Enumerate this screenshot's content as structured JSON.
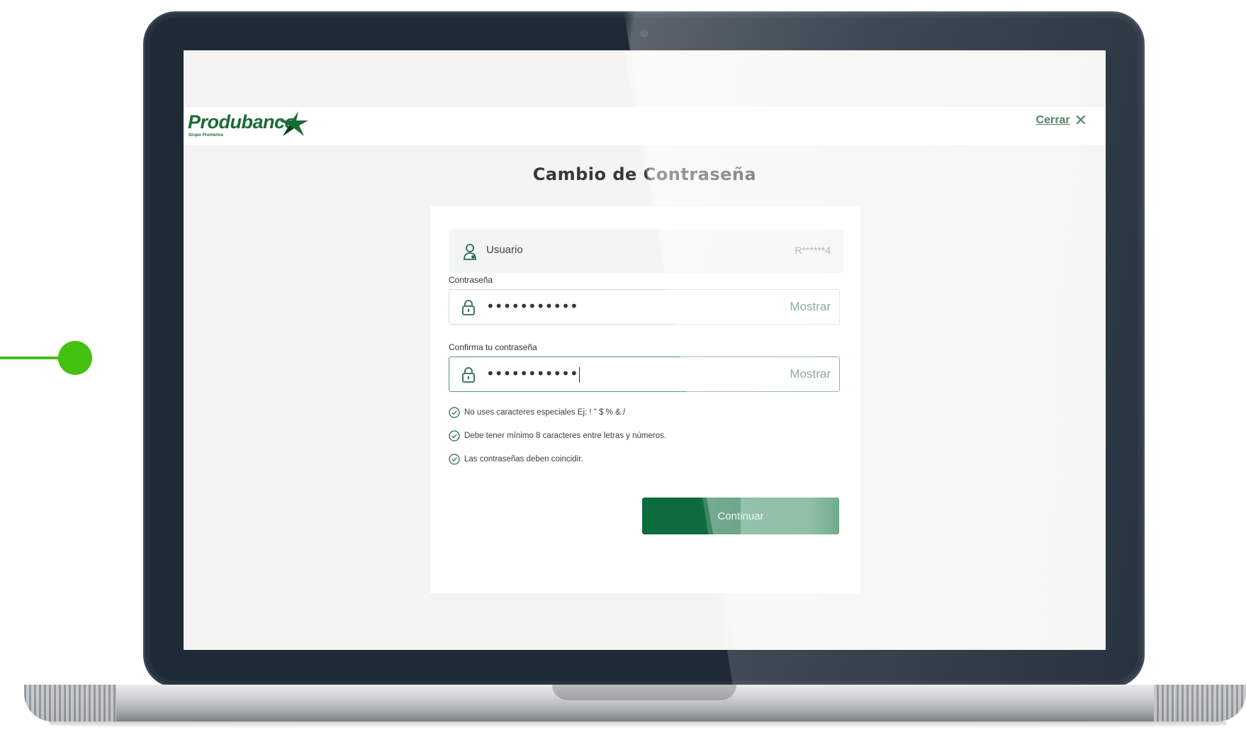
{
  "header": {
    "logo_text": "Produbanco",
    "logo_subtext": "Grupo Promerica",
    "close_label": "Cerrar",
    "close_icon": "close-icon"
  },
  "page": {
    "title": "Cambio de Contraseña"
  },
  "form": {
    "user": {
      "label": "Usuario",
      "value": "R******4",
      "icon": "user-icon"
    },
    "password": {
      "label": "Contraseña",
      "value": "•••••••••••",
      "show_label": "Mostrar",
      "icon": "lock-icon"
    },
    "confirm": {
      "label": "Confirma tu contraseña",
      "value": "•••••••••••",
      "show_label": "Mostrar",
      "icon": "lock-icon"
    },
    "rules": [
      {
        "text": "No uses caracteres especiales Ej: ! \" $ % & /",
        "icon": "check-circle-icon"
      },
      {
        "text": "Debe tener mínimo 8 caracteres entre letras y números.",
        "icon": "check-circle-icon"
      },
      {
        "text": "Las contraseñas deben coincidir.",
        "icon": "check-circle-icon"
      }
    ],
    "submit_label": "Continuar"
  },
  "colors": {
    "brand_green": "#0d6b3d",
    "accent_text": "#4f7f6a",
    "connector": "#44c20f"
  }
}
